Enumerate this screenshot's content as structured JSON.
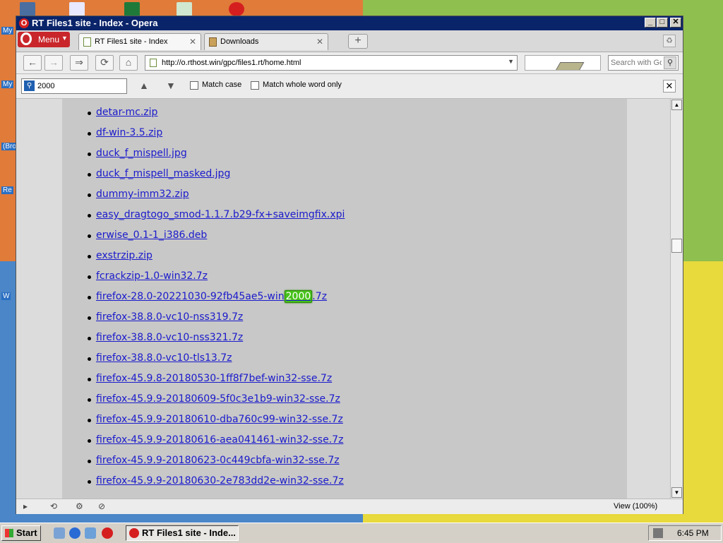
{
  "desktop": {
    "labels": [
      "My",
      "My",
      "(Bro",
      "Re",
      "W"
    ]
  },
  "window": {
    "title": "RT Files1 site - Index - Opera",
    "controls": {
      "minimize": "_",
      "maximize": "□",
      "close": "✕"
    }
  },
  "tabs": {
    "menu_label": "Menu",
    "items": [
      {
        "label": "RT Files1 site - Index",
        "close": "✕"
      },
      {
        "label": "Downloads",
        "close": "✕"
      }
    ],
    "new_tab": "+"
  },
  "nav": {
    "back": "←",
    "forward": "→",
    "fast_forward": "⇒",
    "reload": "⟳",
    "home": "⌂",
    "url": "http://o.rthost.win/gpc/files1.rt/home.html",
    "search_placeholder": "Search with Google"
  },
  "find": {
    "query": "2000",
    "prev": "▲",
    "next": "▼",
    "match_case": "Match case",
    "whole_word": "Match whole word only",
    "close": "✕"
  },
  "files": [
    {
      "name": "detar-mc.zip"
    },
    {
      "name": "df-win-3.5.zip"
    },
    {
      "name": "duck_f_mispell.jpg"
    },
    {
      "name": "duck_f_mispell_masked.jpg"
    },
    {
      "name": "dummy-imm32.zip"
    },
    {
      "name": "easy_dragtogo_smod-1.1.7.b29-fx+saveimgfix.xpi"
    },
    {
      "name": "erwise_0.1-1_i386.deb"
    },
    {
      "name": "exstrzip.zip"
    },
    {
      "name": "fcrackzip-1.0-win32.7z"
    },
    {
      "name_pre": "firefox-28.0-20221030-92fb45ae5-win",
      "name_hl": "2000",
      "name_post": ".7z"
    },
    {
      "name": "firefox-38.8.0-vc10-nss319.7z"
    },
    {
      "name": "firefox-38.8.0-vc10-nss321.7z"
    },
    {
      "name": "firefox-38.8.0-vc10-tls13.7z"
    },
    {
      "name": "firefox-45.9.8-20180530-1ff8f7bef-win32-sse.7z"
    },
    {
      "name": "firefox-45.9.9-20180609-5f0c3e1b9-win32-sse.7z"
    },
    {
      "name": "firefox-45.9.9-20180610-dba760c99-win32-sse.7z"
    },
    {
      "name": "firefox-45.9.9-20180616-aea041461-win32-sse.7z"
    },
    {
      "name": "firefox-45.9.9-20180623-0c449cbfa-win32-sse.7z"
    },
    {
      "name": "firefox-45.9.9-20180630-2e783dd2e-win32-sse.7z"
    }
  ],
  "status": {
    "zoom": "View (100%)",
    "panel": "▸",
    "sync": "⟲",
    "speed": "⚙",
    "ad": "⊘"
  },
  "taskbar": {
    "start": "Start",
    "task_label": "RT Files1 site - Inde...",
    "clock": "6:45 PM"
  },
  "colors": {
    "title_bg": "#0a246a",
    "link": "#1a1acc",
    "highlight": "#47c21a",
    "opera_red": "#c8262b"
  }
}
